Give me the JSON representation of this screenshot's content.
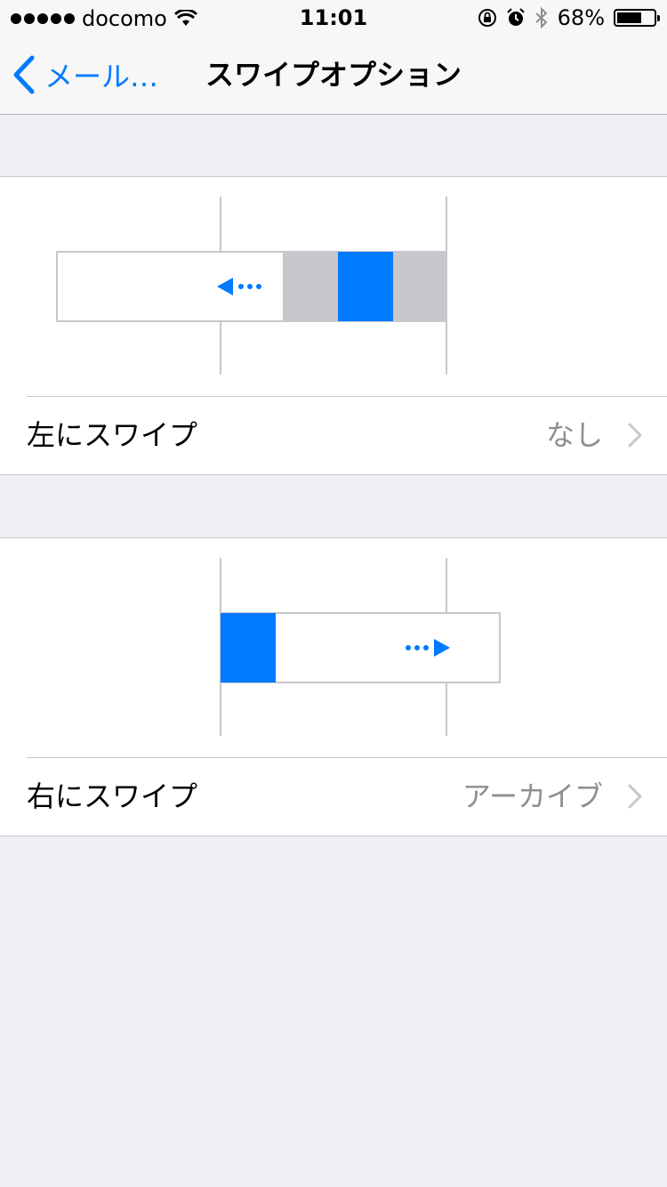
{
  "status_bar": {
    "carrier": "docomo",
    "time": "11:01",
    "battery_percent": "68%",
    "battery_level": 0.68
  },
  "nav": {
    "back_label": "メール…",
    "title": "スワイプオプション"
  },
  "sections": [
    {
      "label": "左にスワイプ",
      "value": "なし"
    },
    {
      "label": "右にスワイプ",
      "value": "アーカイブ"
    }
  ],
  "colors": {
    "accent": "#007aff",
    "action_gray": "#c7c7cc",
    "background": "#efeff4"
  }
}
